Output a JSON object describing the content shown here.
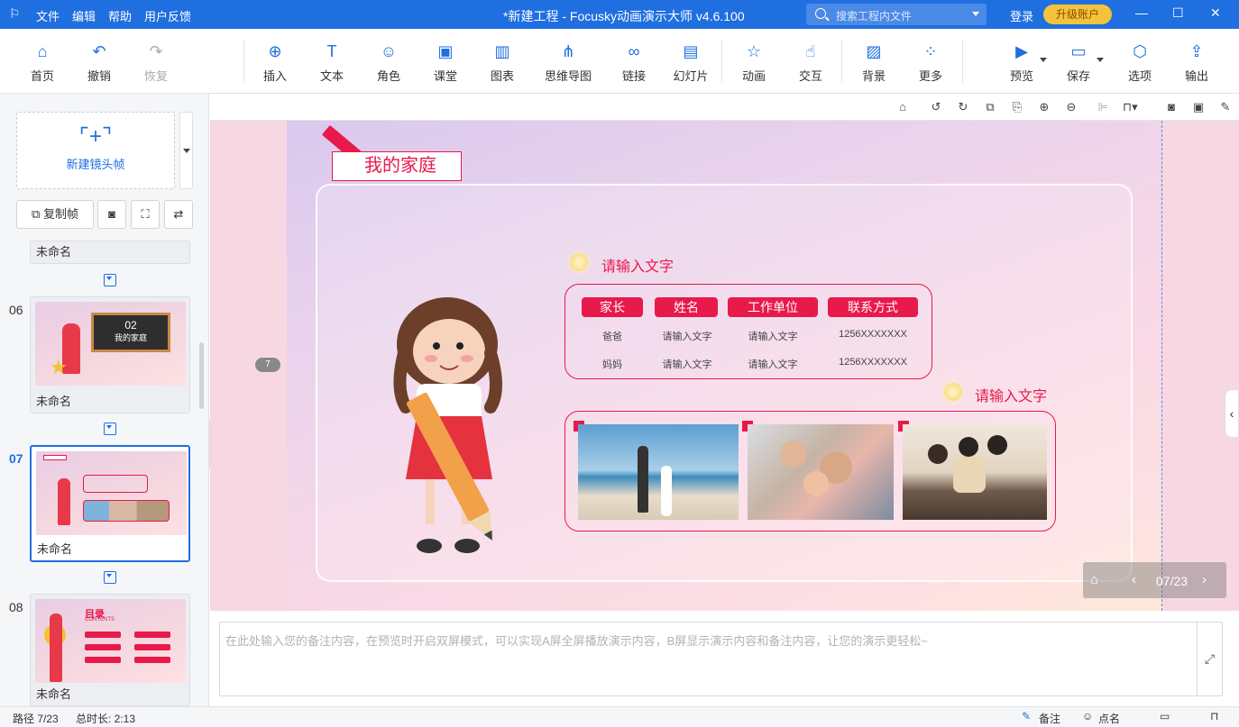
{
  "titlebar": {
    "menu": [
      "文件",
      "编辑",
      "帮助",
      "用户反馈"
    ],
    "title": "*新建工程 - Focusky动画演示大师  v4.6.100",
    "search_placeholder": "搜索工程内文件",
    "login": "登录",
    "upgrade": "升级账户"
  },
  "toolbar": {
    "items": [
      "首页",
      "撤销",
      "恢复",
      "插入",
      "文本",
      "角色",
      "课堂",
      "图表",
      "思维导图",
      "链接",
      "幻灯片",
      "动画",
      "交互",
      "背景",
      "更多",
      "预览",
      "保存",
      "选项",
      "输出"
    ]
  },
  "sidebar": {
    "new_frame": "新建镜头帧",
    "copy_frame": "复制帧",
    "frames": [
      {
        "num": "",
        "name": "未命名"
      },
      {
        "num": "06",
        "name": "未命名",
        "thumb_title": "02",
        "thumb_sub": "我的家庭"
      },
      {
        "num": "07",
        "name": "未命名"
      },
      {
        "num": "08",
        "name": "未命名",
        "thumb_title": "目录",
        "thumb_sub": "CONTENTS"
      }
    ]
  },
  "slide": {
    "title": "我的家庭",
    "subtitle1": "请输入文字",
    "subtitle2": "请输入文字",
    "headers": [
      "家长",
      "姓名",
      "工作单位",
      "联系方式"
    ],
    "rows": [
      [
        "爸爸",
        "请输入文字",
        "请输入文字",
        "1256XXXXXXX"
      ],
      [
        "妈妈",
        "请输入文字",
        "请输入文字",
        "1256XXXXXXX"
      ]
    ],
    "page_badge": "7"
  },
  "nav": {
    "page": "07/23"
  },
  "notes": {
    "placeholder": "在此处输入您的备注内容，在预览时开启双屏模式，可以实现A屏全屏播放演示内容，B屏显示演示内容和备注内容，让您的演示更轻松~"
  },
  "status": {
    "path": "路径 7/23",
    "duration": "总时长: 2:13",
    "notes_btn": "备注",
    "rollcall_btn": "点名"
  }
}
